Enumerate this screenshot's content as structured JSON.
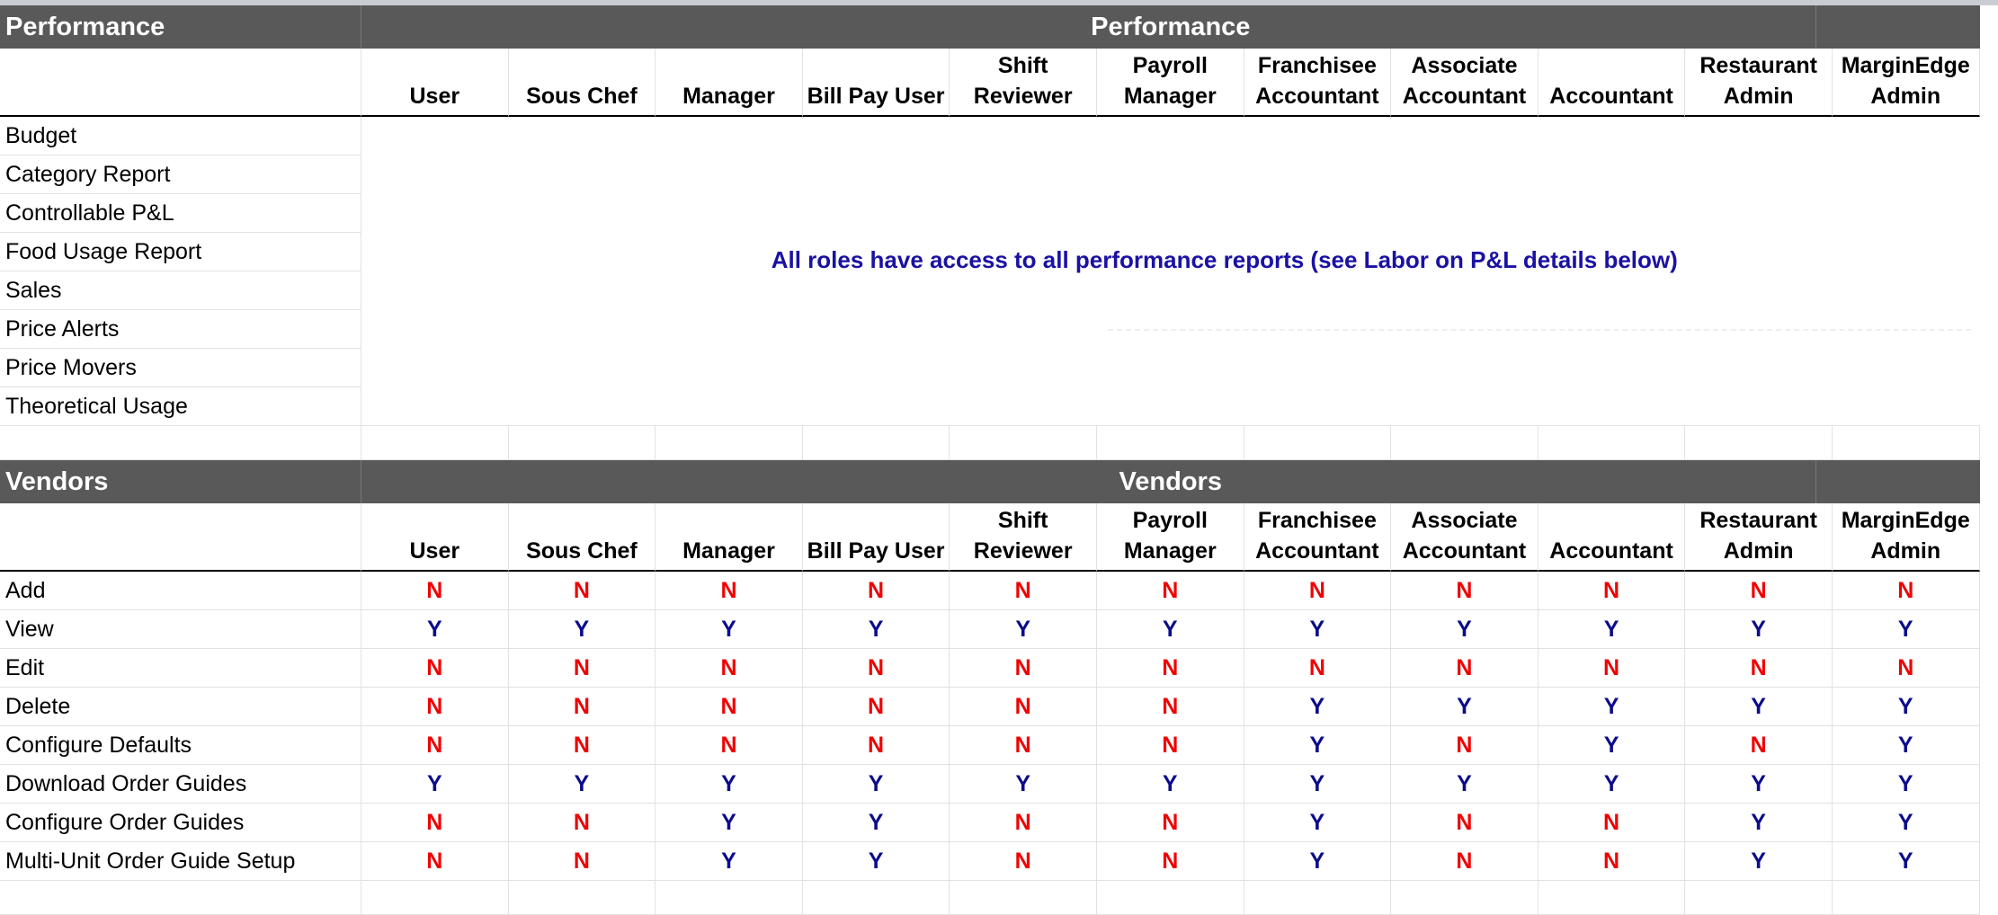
{
  "performance": {
    "label": "Performance",
    "title": "Performance",
    "headers": [
      [
        "User"
      ],
      [
        "Sous Chef"
      ],
      [
        "Manager"
      ],
      [
        "Bill Pay User"
      ],
      [
        "Shift",
        "Reviewer"
      ],
      [
        "Payroll",
        "Manager"
      ],
      [
        "Franchisee",
        "Accountant"
      ],
      [
        "Associate",
        "Accountant"
      ],
      [
        "Accountant"
      ],
      [
        "Restaurant",
        "Admin"
      ],
      [
        "MarginEdge",
        "Admin"
      ]
    ],
    "rows": [
      "Budget",
      "Category Report",
      "Controllable P&L",
      "Food Usage Report",
      "Sales",
      "Price Alerts",
      "Price Movers",
      "Theoretical Usage"
    ],
    "note": "All roles have access to all performance reports (see Labor on P&L details below)"
  },
  "vendors": {
    "label": "Vendors",
    "title": "Vendors",
    "headers": [
      [
        "User"
      ],
      [
        "Sous Chef"
      ],
      [
        "Manager"
      ],
      [
        "Bill Pay User"
      ],
      [
        "Shift",
        "Reviewer"
      ],
      [
        "Payroll",
        "Manager"
      ],
      [
        "Franchisee",
        "Accountant"
      ],
      [
        "Associate",
        "Accountant"
      ],
      [
        "Accountant"
      ],
      [
        "Restaurant",
        "Admin"
      ],
      [
        "MarginEdge",
        "Admin"
      ]
    ],
    "rows": [
      {
        "label": "Add",
        "values": [
          "N",
          "N",
          "N",
          "N",
          "N",
          "N",
          "N",
          "N",
          "N",
          "N",
          "N"
        ]
      },
      {
        "label": "View",
        "values": [
          "Y",
          "Y",
          "Y",
          "Y",
          "Y",
          "Y",
          "Y",
          "Y",
          "Y",
          "Y",
          "Y"
        ]
      },
      {
        "label": "Edit",
        "values": [
          "N",
          "N",
          "N",
          "N",
          "N",
          "N",
          "N",
          "N",
          "N",
          "N",
          "N"
        ]
      },
      {
        "label": "Delete",
        "values": [
          "N",
          "N",
          "N",
          "N",
          "N",
          "N",
          "Y",
          "Y",
          "Y",
          "Y",
          "Y"
        ]
      },
      {
        "label": "Configure Defaults",
        "values": [
          "N",
          "N",
          "N",
          "N",
          "N",
          "N",
          "Y",
          "N",
          "Y",
          "N",
          "Y"
        ]
      },
      {
        "label": "Download Order Guides",
        "values": [
          "Y",
          "Y",
          "Y",
          "Y",
          "Y",
          "Y",
          "Y",
          "Y",
          "Y",
          "Y",
          "Y"
        ]
      },
      {
        "label": "Configure Order Guides",
        "values": [
          "N",
          "N",
          "Y",
          "Y",
          "N",
          "N",
          "Y",
          "N",
          "N",
          "Y",
          "Y"
        ]
      },
      {
        "label": "Multi-Unit Order Guide Setup",
        "values": [
          "N",
          "N",
          "Y",
          "Y",
          "N",
          "N",
          "Y",
          "N",
          "N",
          "Y",
          "Y"
        ]
      }
    ]
  },
  "colors": {
    "section_header_bg": "#595959",
    "yes": "#0b0b8c",
    "no": "#f00000",
    "note": "#1a11a3"
  }
}
